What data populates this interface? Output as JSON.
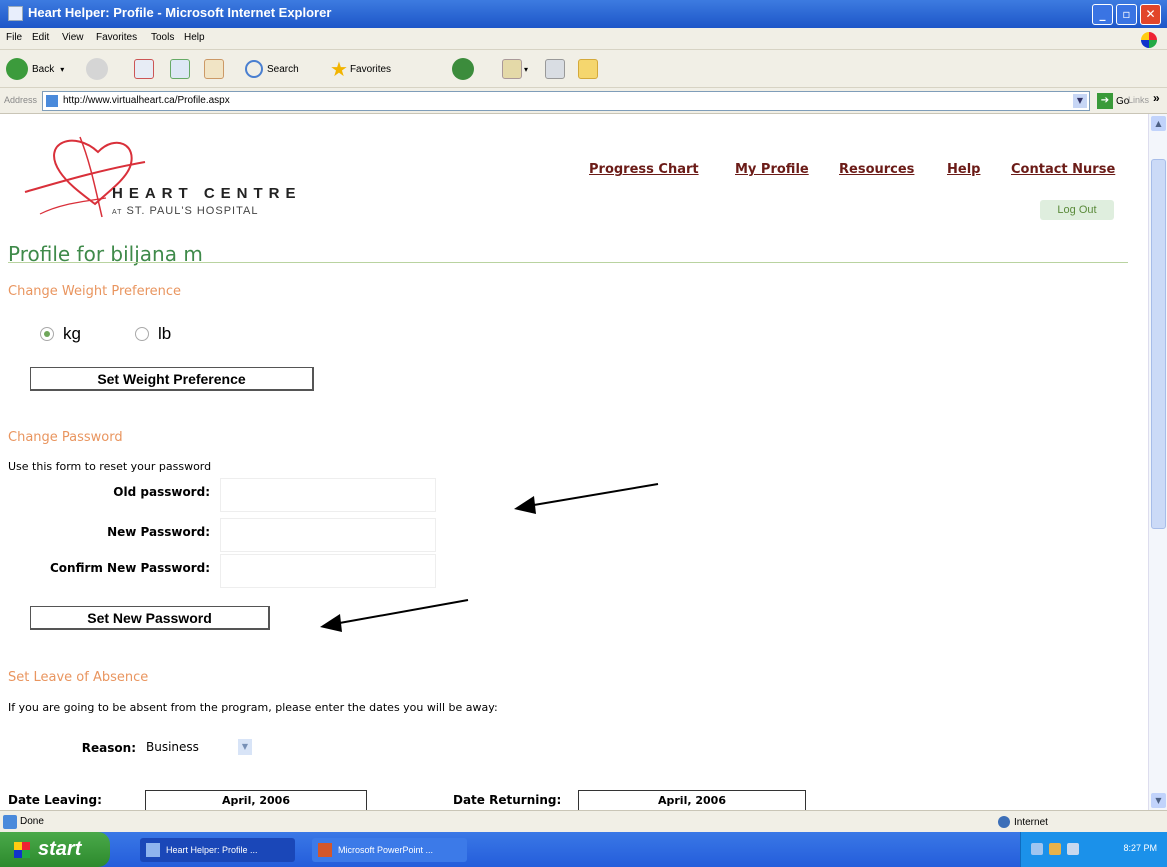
{
  "window": {
    "title": "Heart Helper: Profile - Microsoft Internet Explorer"
  },
  "menu": [
    "File",
    "Edit",
    "View",
    "Favorites",
    "Tools",
    "Help"
  ],
  "toolbar": {
    "back_label": "Back",
    "search_label": "Search",
    "favorites_label": "Favorites"
  },
  "address": {
    "label": "Address",
    "url": "http://www.virtualheart.ca/Profile.aspx",
    "go_label": "Go",
    "links_label": "Links"
  },
  "logo": {
    "line1": "HEART CENTRE",
    "line2_prefix": "AT",
    "line2": "ST. PAUL'S HOSPITAL"
  },
  "nav": {
    "progress_chart": "Progress Chart",
    "my_profile": "My Profile",
    "resources": "Resources",
    "help": "Help",
    "contact_nurse": "Contact Nurse",
    "logout": "Log Out"
  },
  "profile": {
    "title": "Profile for biljana m"
  },
  "weight": {
    "heading": "Change Weight Preference",
    "option_kg": "kg",
    "option_lb": "lb",
    "selected": "kg",
    "button": "Set Weight Preference"
  },
  "password": {
    "heading": "Change Password",
    "intro": "Use this form to reset your password",
    "old_label": "Old password:",
    "new_label": "New Password:",
    "confirm_label": "Confirm New Password:",
    "old_value": "",
    "new_value": "",
    "confirm_value": "",
    "button": "Set New Password"
  },
  "absence": {
    "heading": "Set Leave of Absence",
    "intro": "If you are going to be absent from the program, please enter the dates you will be away:",
    "reason_label": "Reason:",
    "reason_value": "Business",
    "date_leaving_label": "Date Leaving:",
    "date_leaving_value": "April, 2006",
    "date_returning_label": "Date Returning:",
    "date_returning_value": "April, 2006"
  },
  "status": {
    "text": "Done",
    "zone": "Internet"
  },
  "taskbar": {
    "start": "start",
    "task1": "Heart Helper: Profile ...",
    "task2": "Microsoft PowerPoint ...",
    "clock": "8:27 PM"
  },
  "colors": {
    "section_heading": "#e9955f",
    "profile_title": "#3f8a4a",
    "nav_link": "#6b1b17",
    "logo_red": "#d9303a"
  }
}
